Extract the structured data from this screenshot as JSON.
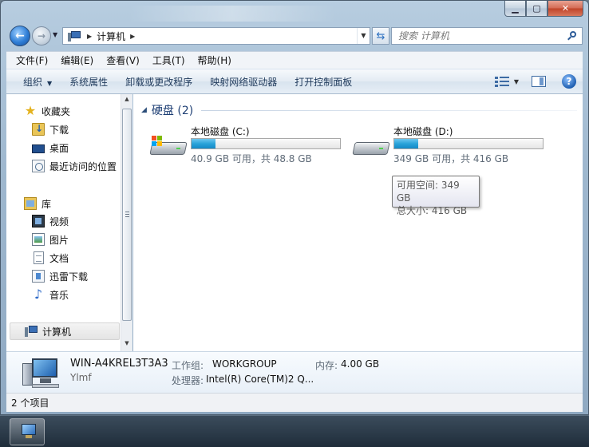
{
  "window": {
    "caption_buttons": {
      "minimize": "▁",
      "maximize": "▢",
      "close": "✕"
    }
  },
  "nav": {
    "back_icon": "←",
    "forward_icon": "→",
    "breadcrumb": [
      "计算机"
    ],
    "search_placeholder": "搜索 计算机"
  },
  "menu": [
    "文件(F)",
    "编辑(E)",
    "查看(V)",
    "工具(T)",
    "帮助(H)"
  ],
  "toolbar": {
    "organize": "组织",
    "items": [
      "系统属性",
      "卸载或更改程序",
      "映射网络驱动器",
      "打开控制面板"
    ]
  },
  "sidebar": {
    "favorites": "收藏夹",
    "favorites_items": [
      "下载",
      "桌面",
      "最近访问的位置"
    ],
    "libraries": "库",
    "library_items": [
      "视频",
      "图片",
      "文档",
      "迅雷下载",
      "音乐"
    ],
    "computer": "计算机"
  },
  "content": {
    "group_title": "硬盘 (2)",
    "drives": [
      {
        "name": "本地磁盘 (C:)",
        "info": "40.9 GB 可用，共 48.8 GB",
        "used_fraction": 0.16
      },
      {
        "name": "本地磁盘 (D:)",
        "info": "349 GB 可用，共 416 GB",
        "used_fraction": 0.16
      }
    ],
    "tooltip": {
      "line1": "可用空间: 349 GB",
      "line2": "总大小: 416 GB"
    }
  },
  "details": {
    "computer_name": "WIN-A4KREL3T3A3",
    "subtitle": "Ylmf",
    "workgroup_label": "工作组:",
    "workgroup_value": "WORKGROUP",
    "memory_label": "内存:",
    "memory_value": "4.00 GB",
    "processor_label": "处理器:",
    "processor_value": "Intel(R) Core(TM)2 Q..."
  },
  "status": {
    "item_count": "2 个项目"
  },
  "colors": {
    "accent": "#2aa3d9",
    "group_title": "#1e3f74"
  }
}
